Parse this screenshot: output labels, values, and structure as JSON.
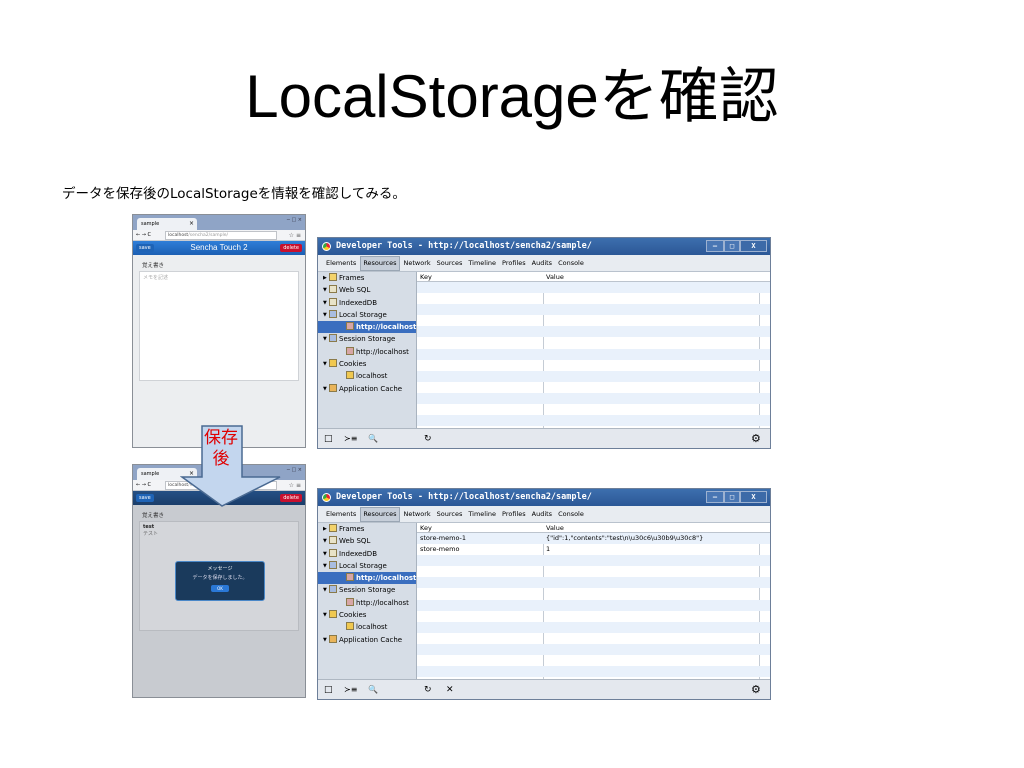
{
  "slide": {
    "title": "LocalStorageを確認",
    "subtitle": "データを保存後のLocalStorageを情報を確認してみる。",
    "arrow_label": "保存後"
  },
  "phone": {
    "tab_title": "sample",
    "tab_close": "×",
    "window_controls": "─ □ ×",
    "nav": "← → C",
    "url_host": "localhost",
    "url_path": "/sencha2/sample/",
    "star_menu": "☆ ≡",
    "save_label": "save",
    "app_title": "Sencha Touch 2",
    "delete_label": "delete",
    "memo_label": "覚え書き",
    "memo_placeholder": "メモを記述"
  },
  "phone_after": {
    "memo_title": "test",
    "memo_text": "テスト",
    "dialog_title": "メッセージ",
    "dialog_text": "データを保存しました。",
    "dialog_ok": "OK"
  },
  "devtools": {
    "window_title": "Developer Tools - http://localhost/sencha2/sample/",
    "window_buttons": [
      "–",
      "□",
      "X"
    ],
    "tabs": [
      "Elements",
      "Resources",
      "Network",
      "Sources",
      "Timeline",
      "Profiles",
      "Audits",
      "Console"
    ],
    "active_tab": "Resources",
    "tree": [
      {
        "label": "Frames",
        "arrow": "▶",
        "indent": 0,
        "icon": "folder-icon"
      },
      {
        "label": "Web SQL",
        "arrow": "▼",
        "indent": 0,
        "icon": "database-icon"
      },
      {
        "label": "IndexedDB",
        "arrow": "▼",
        "indent": 0,
        "icon": "database-icon"
      },
      {
        "label": "Local Storage",
        "arrow": "▼",
        "indent": 0,
        "icon": "storage-icon"
      },
      {
        "label": "http://localhost",
        "arrow": "",
        "indent": 1,
        "icon": "grid-icon",
        "selected": true
      },
      {
        "label": "Session Storage",
        "arrow": "▼",
        "indent": 0,
        "icon": "storage-icon"
      },
      {
        "label": "http://localhost",
        "arrow": "",
        "indent": 1,
        "icon": "grid-icon"
      },
      {
        "label": "Cookies",
        "arrow": "▼",
        "indent": 0,
        "icon": "cookie-icon"
      },
      {
        "label": "localhost",
        "arrow": "",
        "indent": 1,
        "icon": "cookie-icon"
      },
      {
        "label": "Application Cache",
        "arrow": "▼",
        "indent": 0,
        "icon": "cache-icon"
      }
    ],
    "columns": [
      "Key",
      "Value"
    ],
    "bottom_icons": [
      "□",
      "≻≡",
      "🔍",
      "↻"
    ],
    "bottom_icons_after": [
      "□",
      "≻≡",
      "🔍",
      "↻",
      "✕"
    ],
    "gear": "⚙"
  },
  "storage_before": [],
  "storage_after": [
    {
      "key": "store-memo-1",
      "value": "{\"id\":1,\"contents\":\"test\\n\\u30c6\\u30b9\\u30c8\"}"
    },
    {
      "key": "store-memo",
      "value": "1"
    }
  ]
}
